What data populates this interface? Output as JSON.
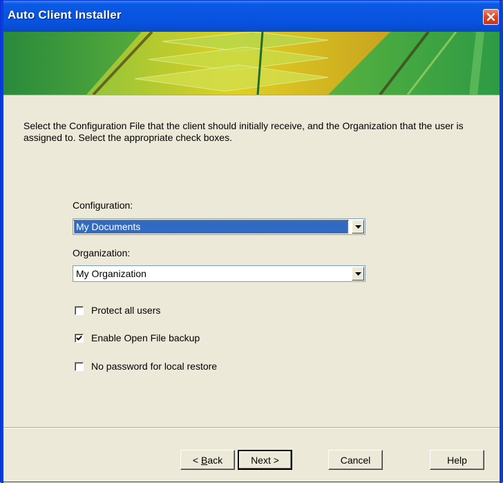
{
  "window": {
    "title": "Auto Client Installer"
  },
  "instructions": "Select the Configuration File that the client should initially receive, and the Organization that the user is assigned to. Select the appropriate check boxes.",
  "configuration": {
    "label": "Configuration:",
    "value": "My Documents"
  },
  "organization": {
    "label": "Organization:",
    "value": "My Organization"
  },
  "checkboxes": [
    {
      "label": "Protect all users",
      "checked": false
    },
    {
      "label": "Enable Open File backup",
      "checked": true
    },
    {
      "label": "No password for local restore",
      "checked": false
    }
  ],
  "buttons": {
    "back_prefix": "< ",
    "back_accel": "B",
    "back_rest": "ack",
    "next": "Next >",
    "cancel": "Cancel",
    "help": "Help"
  },
  "colors": {
    "titlebar": "#0a55e0",
    "selection": "#316ac5",
    "dialog": "#ece9d8",
    "close": "#d9462c"
  }
}
